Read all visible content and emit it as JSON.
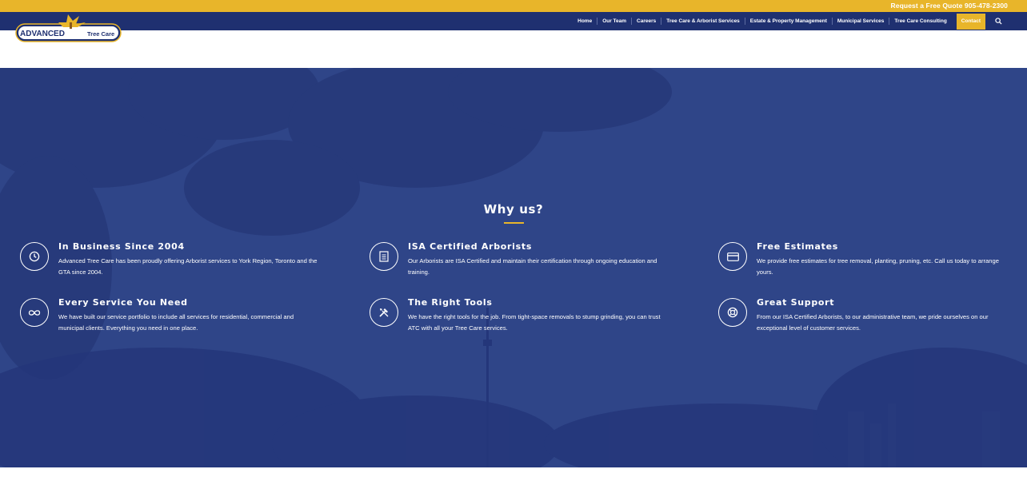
{
  "topbar": {
    "quote_text": "Request a Free Quote 905-478-2300"
  },
  "logo": {
    "brand_main": "ADVANCED",
    "brand_sub": "Tree Care"
  },
  "nav": {
    "items": [
      "Home",
      "Our Team",
      "Careers",
      "Tree Care & Arborist Services",
      "Estate & Property Management",
      "Municipal Services",
      "Tree Care Consulting"
    ],
    "contact": "Contact",
    "search_icon": "search-icon"
  },
  "hero": {
    "title": "Why us?",
    "features": [
      {
        "icon": "clock-icon",
        "title": "In Business Since 2004",
        "text": "Advanced Tree Care has been proudly offering Arborist services to York Region, Toronto and the GTA since 2004."
      },
      {
        "icon": "certificate-icon",
        "title": "ISA Certified Arborists",
        "text": "Our Arborists are ISA Certified and maintain their certification through ongoing education and training."
      },
      {
        "icon": "credit-card-icon",
        "title": "Free Estimates",
        "text": "We provide free estimates for tree removal, planting, pruning, etc. Call us today to arrange yours."
      },
      {
        "icon": "infinity-icon",
        "title": "Every Service You Need",
        "text": "We have built our service portfolio to include all services for residential, commercial and municipal clients. Everything you need in one place."
      },
      {
        "icon": "tools-icon",
        "title": "The Right Tools",
        "text": "We have the right tools for the job. From tight-space removals to stump grinding, you can trust ATC with all your Tree Care services."
      },
      {
        "icon": "life-ring-icon",
        "title": "Great Support",
        "text": "From our ISA Certified Arborists, to our administrative team, we pride ourselves on our exceptional level of customer services."
      }
    ]
  },
  "colors": {
    "accent": "#e8b52a",
    "nav_bg": "#1f3070",
    "hero_bg": "#2e4487"
  }
}
